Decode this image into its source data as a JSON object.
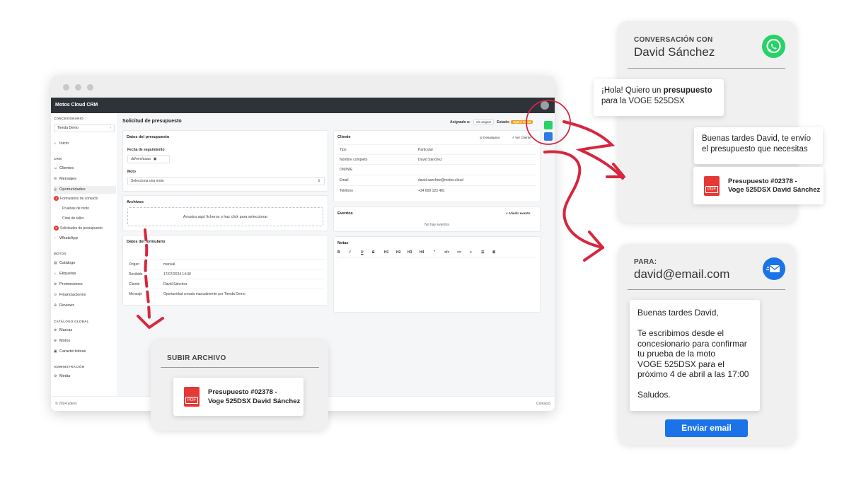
{
  "crm": {
    "app_name": "Motos Cloud CRM",
    "sidebar": {
      "dealer_section": "CONCESIONARIO",
      "dealer_value": "Tienda Demo",
      "home": "Inicio",
      "crm_section": "CRM",
      "crm_items": [
        "Clientes",
        "Mensajes",
        "Oportunidades"
      ],
      "sub_contact": "Formularios de contacto",
      "sub_contact_badge": "1",
      "sub_test": "Pruebas de moto",
      "sub_workshop": "Citas de taller",
      "sub_quotes": "Solicitudes de presupuesto",
      "sub_quotes_badge": "2",
      "whatsapp": "WhatsApp",
      "motos_section": "MOTOS",
      "motos_items": [
        "Catálogo",
        "Etiquetas",
        "Promociones",
        "Financiaciones",
        "Reviews"
      ],
      "global_section": "CATÁLOGO GLOBAL",
      "global_items": [
        "Marcas",
        "Motos",
        "Características"
      ],
      "admin_section": "ADMINISTRACIÓN",
      "admin_items": [
        "Media"
      ]
    },
    "page_title": "Solicitud de presupuesto",
    "assigned_label": "Asignado a:",
    "assigned_value": "Sin asignar",
    "state_label": "Estado:",
    "state_value": "Open / Initial",
    "quote_card": {
      "title": "Datos del presupuesto",
      "followup_label": "Fecha de seguimiento",
      "followup_placeholder": "dd/mm/aaaa",
      "moto_label": "Moto",
      "moto_placeholder": "Selecciona una moto"
    },
    "files_card": {
      "title": "Archivos",
      "dropzone": "Arrastra aquí ficheros o haz click para seleccionar"
    },
    "form_card": {
      "title": "Datos del formulario",
      "rows": [
        {
          "k": "Origen",
          "v": "manual"
        },
        {
          "k": "Recibido",
          "v": "17/07/2024 14:30"
        },
        {
          "k": "Cliente",
          "v": "David Sánchez"
        },
        {
          "k": "Mensaje",
          "v": "Oportunidad creada manualmente por Tienda Demo"
        }
      ]
    },
    "client_card": {
      "title": "Cliente",
      "unassign": "Desasignar",
      "view": "Ver Cliente",
      "rows": [
        {
          "k": "Tipo",
          "v": "Particular"
        },
        {
          "k": "Nombre completo",
          "v": "David Sánchez"
        },
        {
          "k": "DNI/NIE",
          "v": ""
        },
        {
          "k": "Email",
          "v": "david.sanchez@motos.cloud"
        },
        {
          "k": "Teléfono",
          "v": "+34 600 123 481"
        }
      ]
    },
    "events_card": {
      "title": "Eventos",
      "add": "+ Añadir evento",
      "empty": "No hay eventos"
    },
    "notes_card": {
      "title": "Notas",
      "toolbar": [
        "B",
        "I",
        "U",
        "S",
        "H1",
        "H2",
        "H3",
        "H4",
        "\"",
        "</>",
        "<>",
        "≡",
        "☰",
        "≣"
      ]
    },
    "footer_left": "© 2024 ydevs",
    "footer_right": "Contacto"
  },
  "upload_panel": {
    "label": "SUBIR ARCHIVO",
    "pdf_title_1": "Presupuesto #02378 -",
    "pdf_title_2": "Voge 525DSX David Sánchez",
    "pdf_badge": "PDF"
  },
  "whatsapp_panel": {
    "label": "CONVERSACIÓN CON",
    "name": "David Sánchez",
    "msg_in_1": "¡Hola! Quiero un ",
    "msg_in_bold": "presupuesto",
    "msg_in_2": "para la VOGE 525DSX",
    "msg_out_1": "Buenas tardes David, te envío",
    "msg_out_2": "el presupuesto que necesitas",
    "pdf_title_1": "Presupuesto #02378 -",
    "pdf_title_2": "Voge 525DSX David Sánchez",
    "pdf_badge": "PDF"
  },
  "email_panel": {
    "label": "PARA:",
    "address": "david@email.com",
    "body": [
      "Buenas tardes David,",
      "",
      "Te escribimos desde el",
      "concesionario para confirmar",
      "tu prueba de la moto",
      "VOGE 525DSX para el",
      "próximo 4 de abril a las 17:00",
      "",
      "Saludos."
    ],
    "send": "Enviar email"
  },
  "colors": {
    "whatsapp": "#25d366",
    "email": "#1a73e8",
    "arrow": "#d7263d",
    "pdf": "#e53935"
  }
}
